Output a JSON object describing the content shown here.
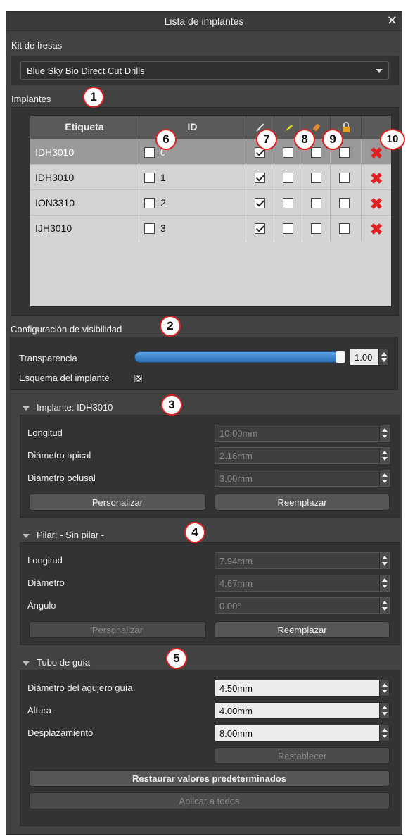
{
  "window": {
    "title": "Lista de implantes",
    "close_glyph": "✕"
  },
  "drill_kit": {
    "label": "Kit de fresas",
    "value": "Blue Sky Bio Direct Cut Drills"
  },
  "implants": {
    "label": "Implantes",
    "columns": [
      "Etiqueta",
      "ID"
    ],
    "rows": [
      {
        "label": "IDH3010",
        "id": "0",
        "visible": true,
        "c8": false,
        "c9": false,
        "lock": false
      },
      {
        "label": "IDH3010",
        "id": "1",
        "visible": true,
        "c8": false,
        "c9": false,
        "lock": false
      },
      {
        "label": "ION3310",
        "id": "2",
        "visible": true,
        "c8": false,
        "c9": false,
        "lock": false
      },
      {
        "label": "IJH3010",
        "id": "3",
        "visible": true,
        "c8": false,
        "c9": false,
        "lock": false
      }
    ],
    "header_icons": [
      "pen-icon",
      "pin-icon",
      "brush-icon",
      "lock-icon"
    ],
    "delete_icon": "delete-x-icon",
    "delete_color": "#e02020"
  },
  "visibility": {
    "label": "Configuración de visibilidad",
    "transparency_label": "Transparencia",
    "transparency_value": "1.00",
    "transparency_level": 1.0,
    "outline_label": "Esquema del implante",
    "accent": "#2a6fb8"
  },
  "implant_section": {
    "title": "Implante: IDH3010",
    "fields": [
      {
        "label": "Longitud",
        "value": "10.00mm"
      },
      {
        "label": "Diámetro apical",
        "value": "2.16mm"
      },
      {
        "label": "Diámetro oclusal",
        "value": "3.00mm"
      }
    ],
    "customize": "Personalizar",
    "replace": "Reemplazar"
  },
  "abutment_section": {
    "title": "Pilar: - Sin pilar -",
    "fields": [
      {
        "label": "Longitud",
        "value": "7.94mm"
      },
      {
        "label": "Diámetro",
        "value": "4.67mm"
      },
      {
        "label": "Ángulo",
        "value": "0.00°"
      }
    ],
    "customize": "Personalizar",
    "replace": "Reemplazar"
  },
  "guide_tube": {
    "title": "Tubo de guía",
    "fields": [
      {
        "label": "Diámetro del agujero guía",
        "value": "4.50mm"
      },
      {
        "label": "Altura",
        "value": "4.00mm"
      },
      {
        "label": "Desplazamiento",
        "value": "8.00mm"
      }
    ],
    "reset": "Restablecer",
    "restore_defaults": "Restaurar valores predeterminados",
    "apply_all": "Aplicar a todos"
  },
  "callouts": [
    "1",
    "2",
    "3",
    "4",
    "5",
    "6",
    "7",
    "8",
    "9",
    "10"
  ]
}
